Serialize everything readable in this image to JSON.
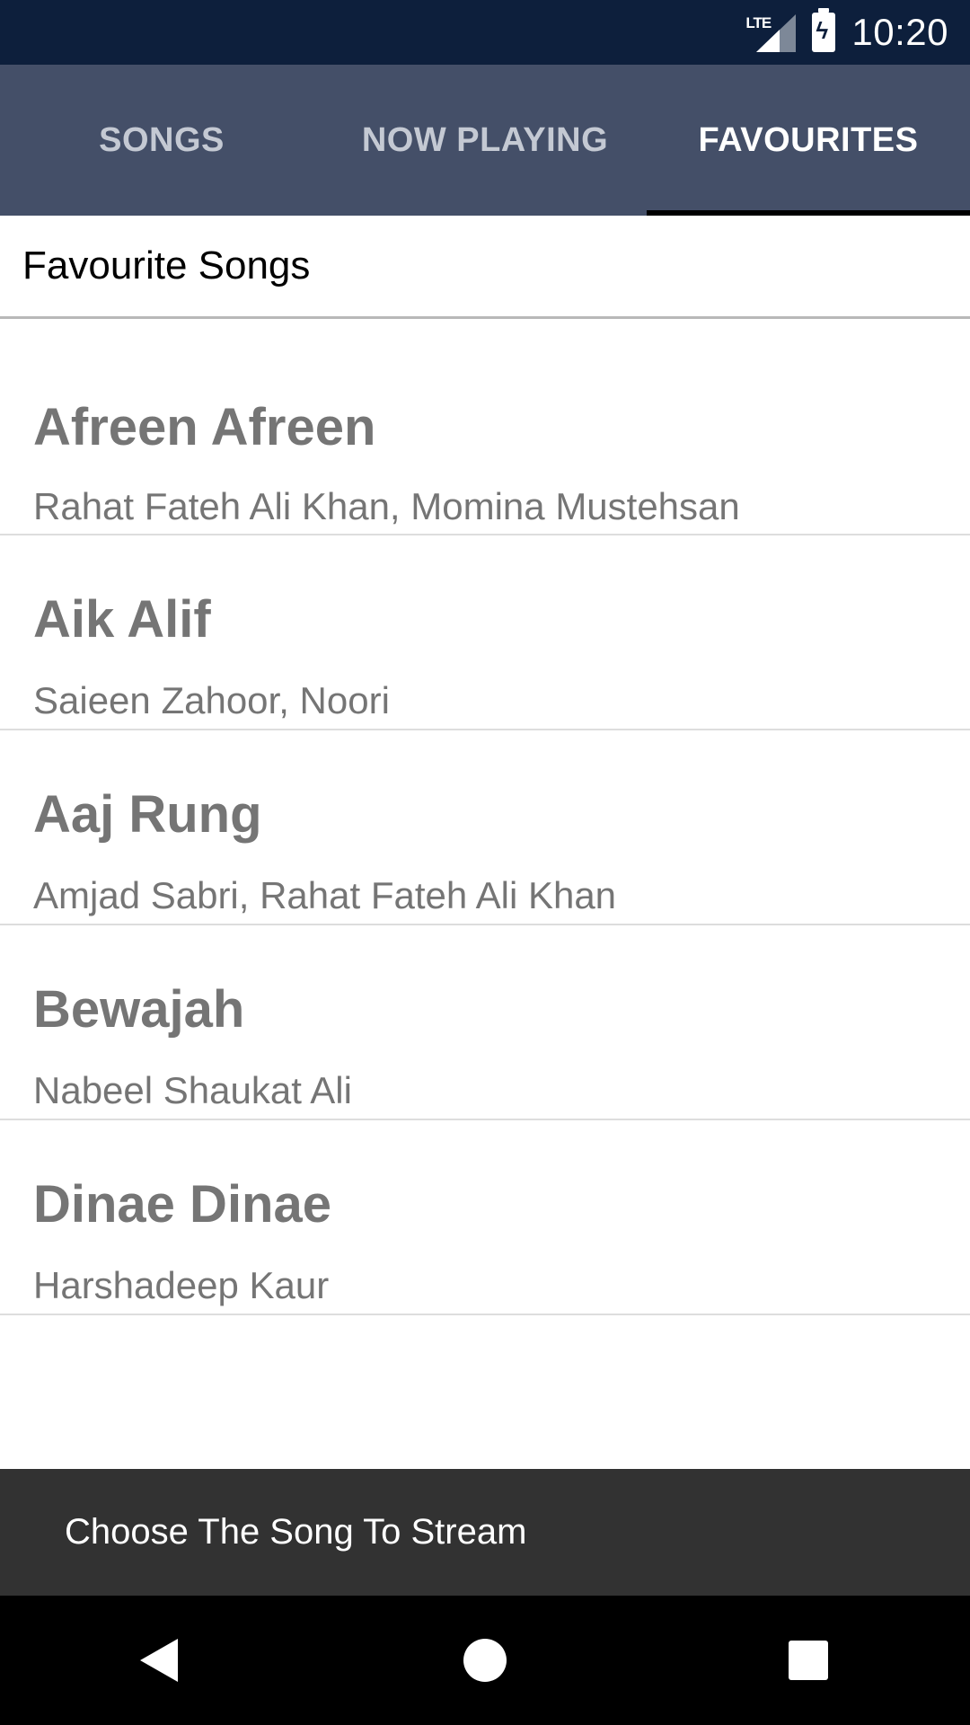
{
  "status_bar": {
    "network": "LTE",
    "time": "10:20",
    "icons": [
      "lte-signal-icon",
      "battery-charging-icon"
    ]
  },
  "tabs": [
    {
      "label": "SONGS",
      "selected": false
    },
    {
      "label": "NOW PLAYING",
      "selected": false
    },
    {
      "label": "FAVOURITES",
      "selected": true
    }
  ],
  "header": {
    "title": "Favourite Songs"
  },
  "songs": [
    {
      "title": "Afreen Afreen",
      "artist": "Rahat Fateh Ali Khan, Momina Mustehsan"
    },
    {
      "title": "Aik Alif",
      "artist": "Saieen Zahoor, Noori"
    },
    {
      "title": "Aaj Rung",
      "artist": "Amjad Sabri,  Rahat Fateh Ali Khan"
    },
    {
      "title": "Bewajah",
      "artist": "Nabeel Shaukat Ali"
    },
    {
      "title": "Dinae Dinae",
      "artist": "Harshadeep Kaur"
    }
  ],
  "snackbar": {
    "message": "Choose The Song To Stream"
  },
  "nav_bar": {
    "icons": [
      "back-icon",
      "home-icon",
      "recents-icon"
    ]
  },
  "colors": {
    "status_bar": "#0d1f3c",
    "tab_bar": "#444f68",
    "tab_indicator": "#000000",
    "song_text": "#757575",
    "snackbar": "#323232"
  }
}
